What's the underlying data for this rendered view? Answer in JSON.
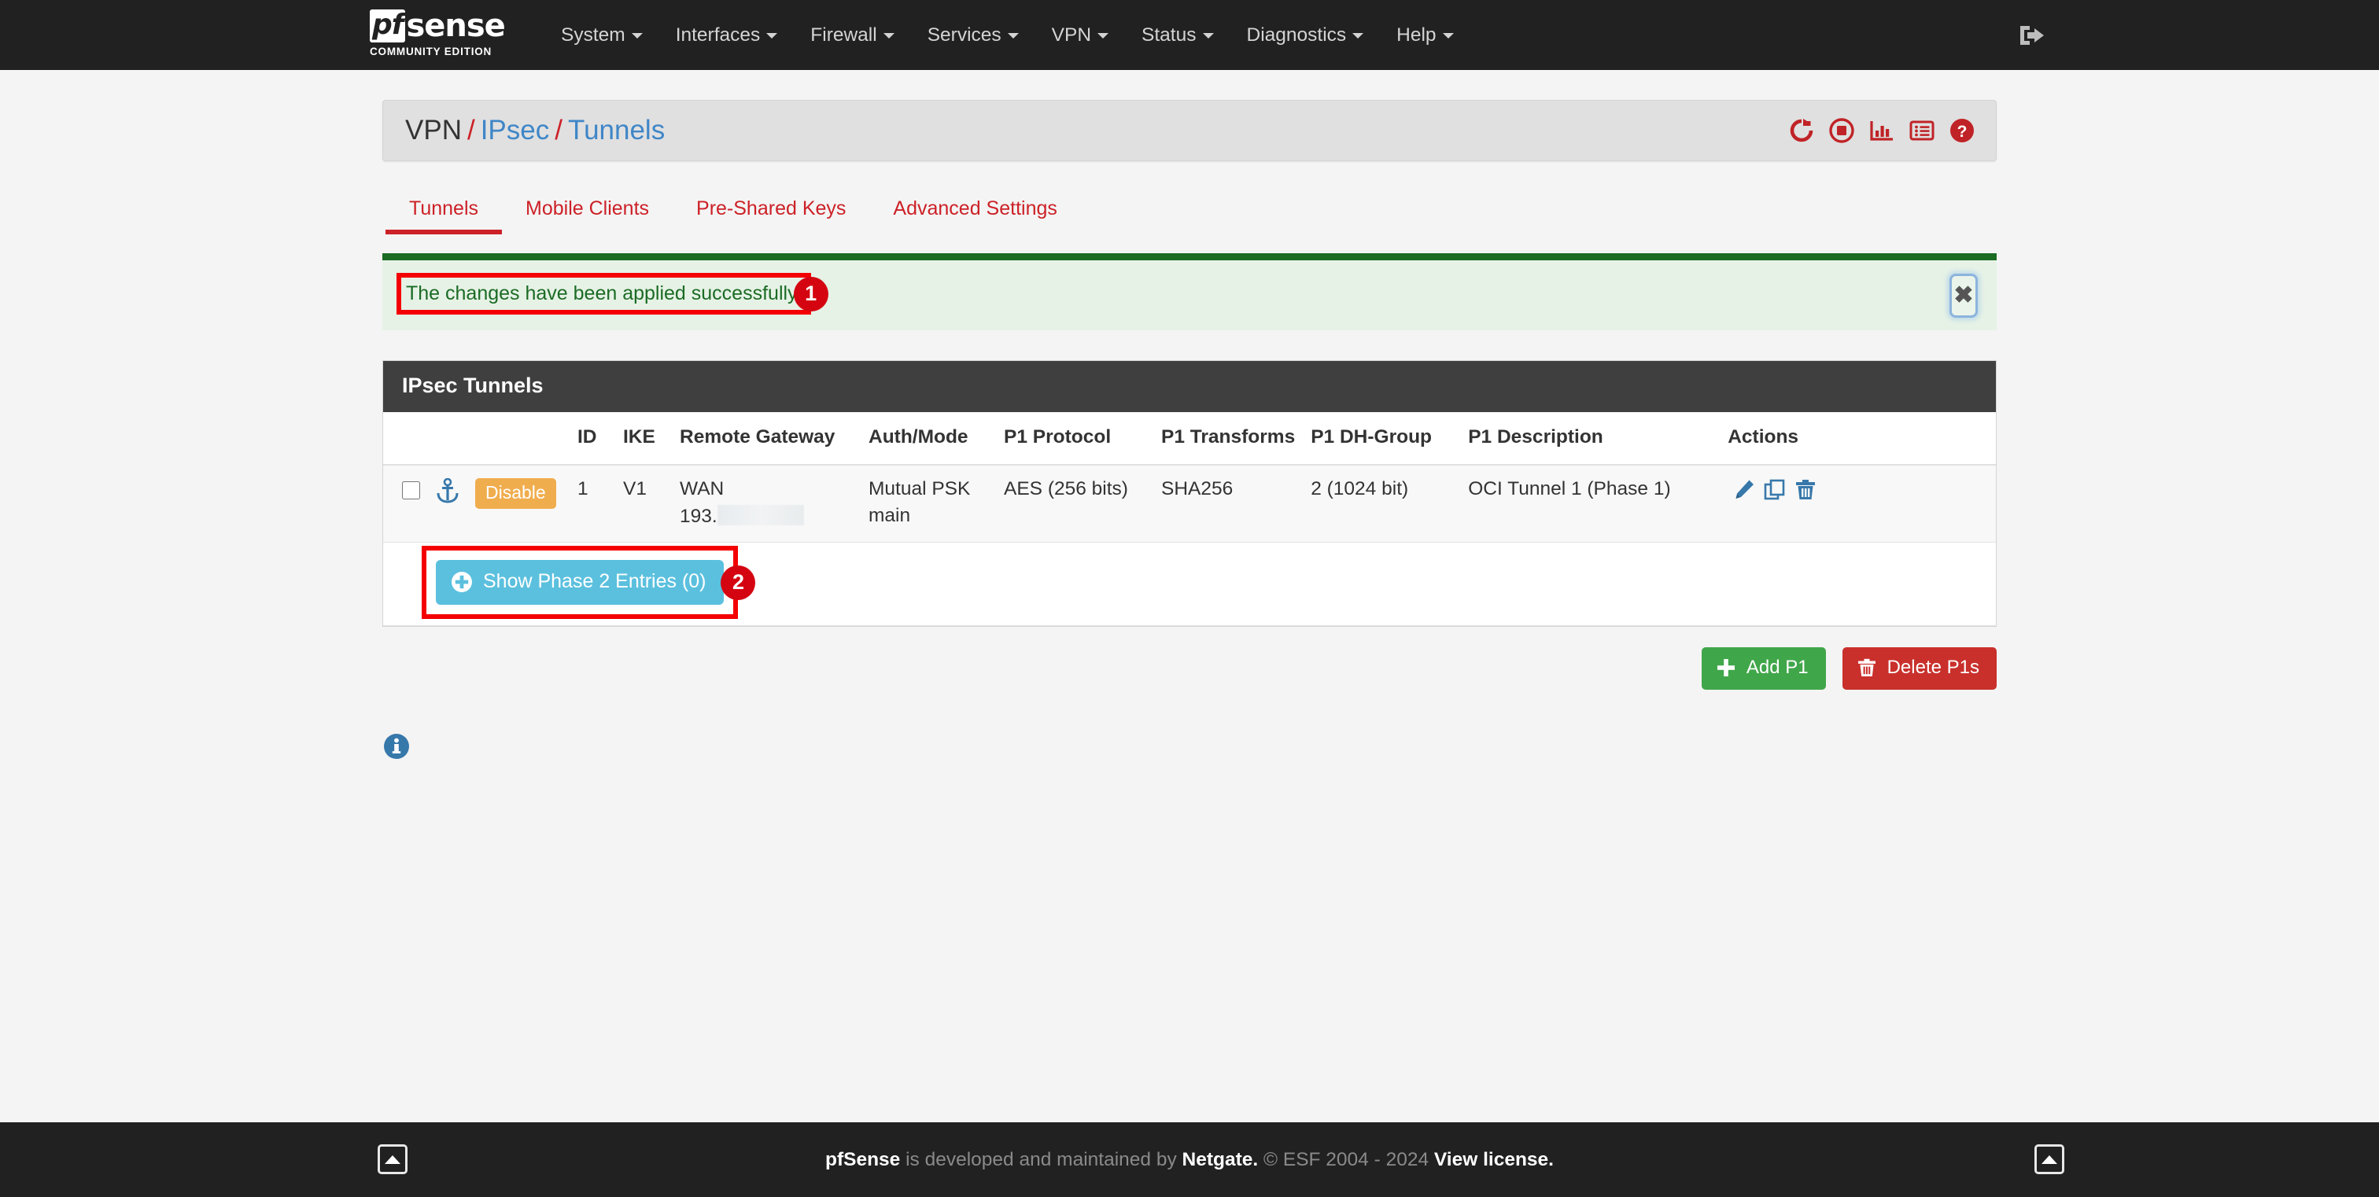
{
  "navbar": {
    "brand_pf": "pf",
    "brand_sense": "sense",
    "brand_subtitle": "COMMUNITY EDITION",
    "items": [
      {
        "label": "System",
        "icon": "chevron-down-icon"
      },
      {
        "label": "Interfaces",
        "icon": "chevron-down-icon"
      },
      {
        "label": "Firewall",
        "icon": "chevron-down-icon"
      },
      {
        "label": "Services",
        "icon": "chevron-down-icon"
      },
      {
        "label": "VPN",
        "icon": "chevron-down-icon"
      },
      {
        "label": "Status",
        "icon": "chevron-down-icon"
      },
      {
        "label": "Diagnostics",
        "icon": "chevron-down-icon"
      },
      {
        "label": "Help",
        "icon": "chevron-down-icon"
      }
    ],
    "logout_icon": "sign-out-icon"
  },
  "page_head": {
    "breadcrumb": {
      "root": "VPN",
      "sep1": "/",
      "mid": "IPsec",
      "sep2": "/",
      "leaf": "Tunnels"
    },
    "icons": [
      {
        "name": "restart-icon",
        "title": "Restart IPsec"
      },
      {
        "name": "stop-icon",
        "title": "Stop IPsec"
      },
      {
        "name": "status-chart-icon",
        "title": "Status"
      },
      {
        "name": "logs-list-icon",
        "title": "Logs"
      },
      {
        "name": "help-icon",
        "title": "Help"
      }
    ],
    "icon_color": "#c02327"
  },
  "tabs": [
    {
      "label": "Tunnels",
      "active": true
    },
    {
      "label": "Mobile Clients",
      "active": false
    },
    {
      "label": "Pre-Shared Keys",
      "active": false
    },
    {
      "label": "Advanced Settings",
      "active": false
    }
  ],
  "alert": {
    "message": "The changes have been applied successfully.",
    "close_icon": "close-icon",
    "close_glyph": "✖",
    "bar_color": "#1b6b24",
    "bg_color": "#e6f2e6",
    "text_color": "#1b6b24"
  },
  "panel": {
    "title": "IPsec Tunnels",
    "columns": [
      "",
      "",
      "",
      "ID",
      "IKE",
      "Remote Gateway",
      "Auth/Mode",
      "P1 Protocol",
      "P1 Transforms",
      "P1 DH-Group",
      "P1 Description",
      "Actions"
    ],
    "rows": [
      {
        "selected": false,
        "anchor_icon": "anchor-icon",
        "status_label": "Disable",
        "status_color": "#f0ad4e",
        "id": "1",
        "ike": "V1",
        "remote_gateway_line1": "WAN",
        "remote_gateway_line2": "193.",
        "remote_gateway_redacted": true,
        "auth": "Mutual PSK",
        "mode": "main",
        "p1_protocol": "AES (256 bits)",
        "p1_transforms": "SHA256",
        "p1_dh_group": "2 (1024 bit)",
        "p1_description": "OCI Tunnel 1 (Phase 1)",
        "actions": [
          {
            "name": "edit-icon",
            "title": "Edit"
          },
          {
            "name": "copy-icon",
            "title": "Copy"
          },
          {
            "name": "delete-icon",
            "title": "Delete"
          }
        ]
      }
    ],
    "show_phase2_button": {
      "label": "Show Phase 2 Entries (0)",
      "icon": "plus-circle-icon",
      "color": "#5bc0de"
    }
  },
  "table_actions": [
    {
      "label": "Add P1",
      "icon": "plus-icon",
      "style": "success"
    },
    {
      "label": "Delete P1s",
      "icon": "trash-icon",
      "style": "danger"
    }
  ],
  "info": {
    "icon": "info-circle-icon",
    "color": "#3778ab"
  },
  "footer": {
    "brand": "pfSense",
    "text_mid": " is developed and maintained by ",
    "company": "Netgate.",
    "copyright": " © ESF 2004 - 2024 ",
    "license_link": "View license.",
    "left_button_icon": "caret-up-icon",
    "right_button_icon": "caret-up-icon"
  },
  "annotations": [
    {
      "number": "1",
      "target": "alert-message"
    },
    {
      "number": "2",
      "target": "show-phase2-button"
    }
  ]
}
